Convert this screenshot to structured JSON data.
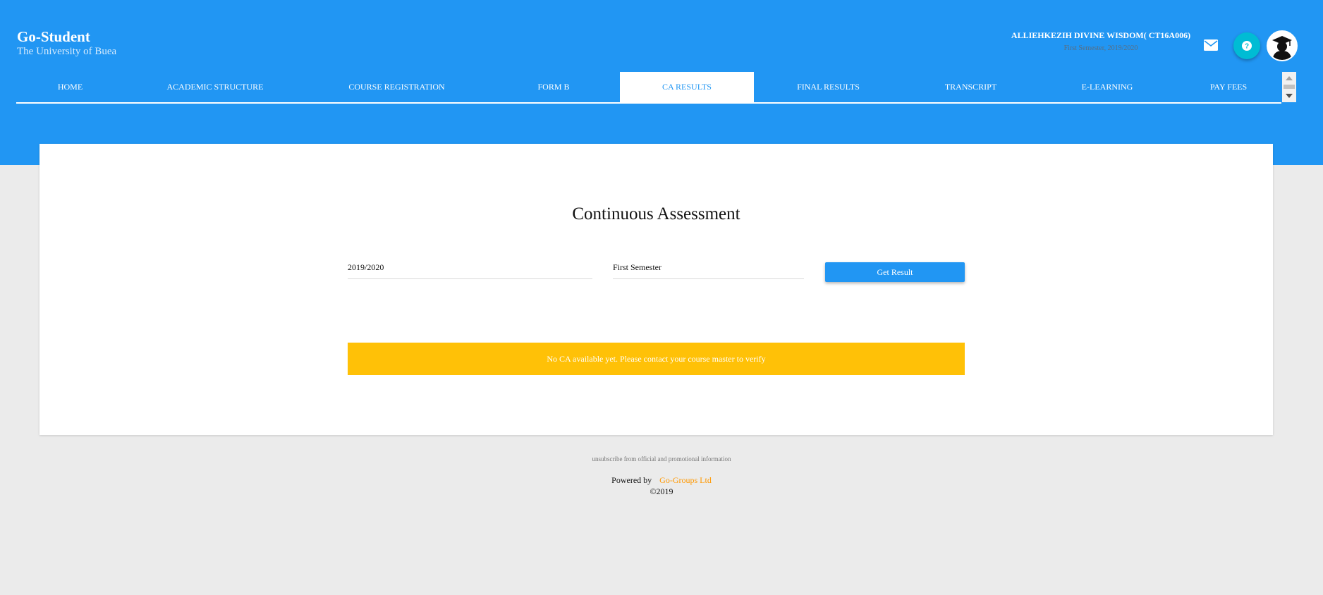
{
  "brand": {
    "title": "Go-Student",
    "subtitle": "The University of Buea"
  },
  "user": {
    "name": "ALLIEHKEZIH DIVINE WISDOM( CT16A006)",
    "term": "First Semester, 2019/2020"
  },
  "icons": {
    "mail": "mail-icon",
    "help": "help-icon",
    "avatar": "graduate-avatar-icon"
  },
  "nav": {
    "items": [
      {
        "label": "HOME"
      },
      {
        "label": "ACADEMIC STRUCTURE"
      },
      {
        "label": "COURSE REGISTRATION"
      },
      {
        "label": "FORM B"
      },
      {
        "label": "CA RESULTS",
        "active": true
      },
      {
        "label": "FINAL RESULTS"
      },
      {
        "label": "TRANSCRIPT"
      },
      {
        "label": "E-LEARNING"
      },
      {
        "label": "PAY FEES"
      }
    ]
  },
  "main": {
    "title": "Continuous Assessment",
    "year_value": "2019/2020",
    "semester_value": "First Semester",
    "button_label": "Get Result",
    "alert_text": "No CA available yet. Please contact your course master to verify"
  },
  "footer": {
    "unsubscribe": "unsubscribe from official and promotional information",
    "powered_by": "Powered by",
    "company": "Go-Groups Ltd",
    "copyright": "©2019"
  },
  "colors": {
    "primary": "#2196f3",
    "help": "#00bcd4",
    "alert": "#ffc107",
    "company_link": "#ff9800",
    "background": "#ebebeb"
  }
}
